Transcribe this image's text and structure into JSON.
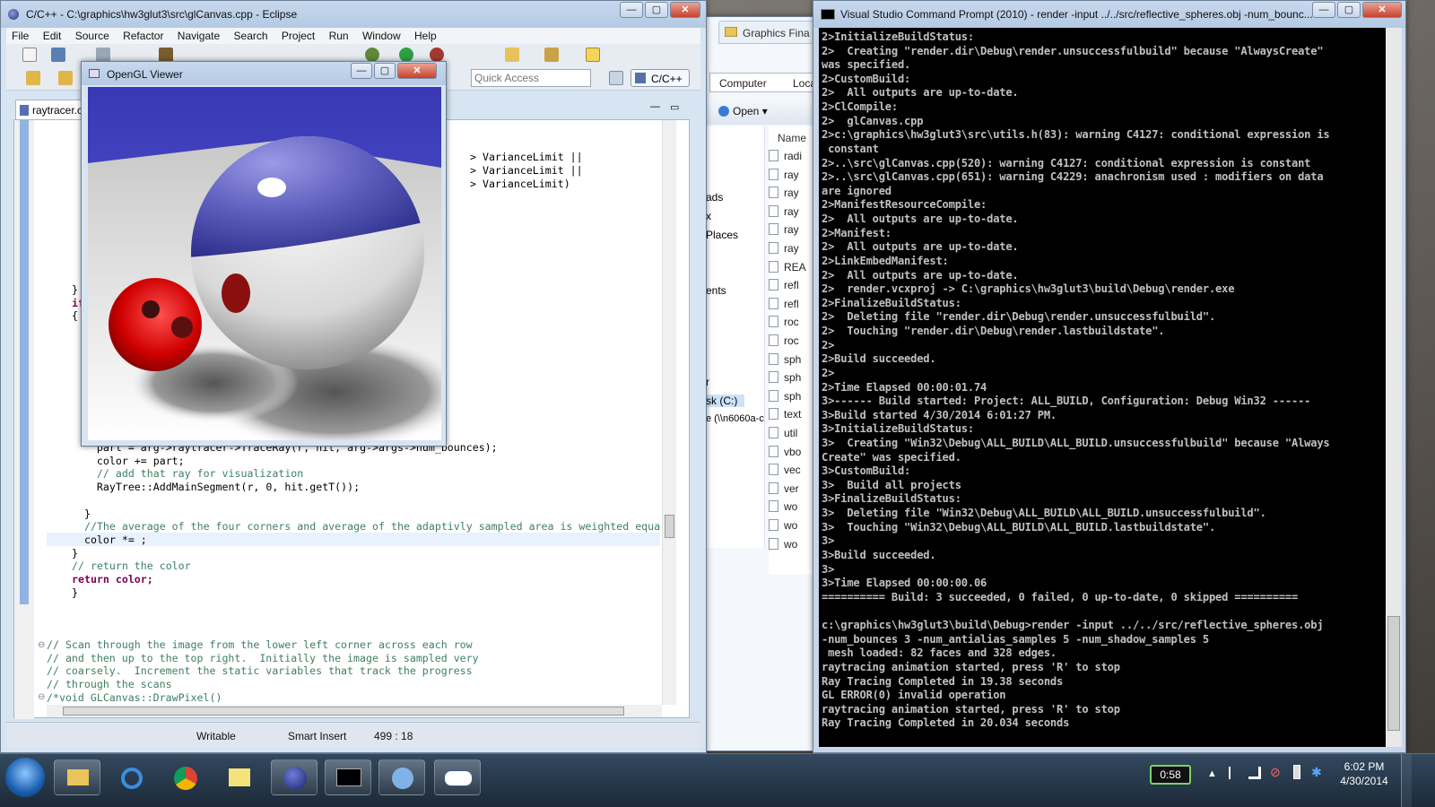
{
  "eclipse": {
    "title": "C/C++ - C:\\graphics\\hw3glut3\\src\\glCanvas.cpp - Eclipse",
    "menu": [
      "File",
      "Edit",
      "Source",
      "Refactor",
      "Navigate",
      "Search",
      "Project",
      "Run",
      "Window",
      "Help"
    ],
    "quick_access": "Quick Access",
    "perspective": "C/C++",
    "tab_label": "raytracer.c",
    "status": {
      "writable": "Writable",
      "insert_mode": "Smart Insert",
      "position": "499 : 18"
    },
    "code_lines_top": [
      {
        "t": "> VarianceLimit ||",
        "c": "code"
      },
      {
        "t": "> VarianceLimit ||",
        "c": "code"
      },
      {
        "t": "> VarianceLimit)",
        "c": "code"
      }
    ],
    "code_fragments": [
      {
        "t": "}",
        "c": "code"
      },
      {
        "t": "if",
        "c": "kw"
      },
      {
        "t": "{",
        "c": "code"
      }
    ],
    "code_lines_bottom": [
      {
        "t": "    part = arg->raytracer->TraceRay(r, hit, arg->args->num_bounces);",
        "c": "code"
      },
      {
        "t": "    color += part;",
        "c": "code"
      },
      {
        "t": "    // add that ray for visualization",
        "c": "cm"
      },
      {
        "t": "    RayTree::AddMainSegment(r, 0, hit.getT());",
        "c": "code"
      },
      {
        "t": "",
        "c": "code"
      },
      {
        "t": "  }",
        "c": "code"
      },
      {
        "t": "  //The average of the four corners and average of the adaptivly sampled area is weighted equa",
        "c": "cm"
      },
      {
        "t": "  color *= ;",
        "c": "code"
      },
      {
        "t": "}",
        "c": "code"
      },
      {
        "t": "// return the color",
        "c": "cm"
      },
      {
        "t": "return color;",
        "c": "kw"
      },
      {
        "t": "}",
        "c": "code"
      }
    ],
    "code_lines_comment": [
      {
        "t": "// Scan through the image from the lower left corner across each row",
        "c": "cm"
      },
      {
        "t": "// and then up to the top right.  Initially the image is sampled very",
        "c": "cm"
      },
      {
        "t": "// coarsely.  Increment the static variables that track the progress",
        "c": "cm"
      },
      {
        "t": "// through the scans",
        "c": "cm"
      },
      {
        "t": "/*void GLCanvas::DrawPixel()",
        "c": "cm"
      }
    ]
  },
  "opengl": {
    "title": "OpenGL Viewer"
  },
  "explorer": {
    "tab_title": "Graphics Fina",
    "breadcrumb": [
      "Computer",
      "Local"
    ],
    "open_button": "Open",
    "sidebar": [
      "ads",
      "x",
      "Places",
      "ents",
      "r",
      "sk (C:)",
      "e (\\\\n6060a-c"
    ],
    "name_header": "Name",
    "files": [
      "radi",
      "ray",
      "ray",
      "ray",
      "ray",
      "ray",
      "REA",
      "refl",
      "refl",
      "roc",
      "roc",
      "sph",
      "sph",
      "sph",
      "text",
      "util",
      "vbo",
      "vec",
      "ver",
      "wo",
      "wo",
      "wo"
    ]
  },
  "terminal": {
    "title": "Visual Studio Command Prompt (2010) - render  -input ../../src/reflective_spheres.obj -num_bounc...",
    "lines": [
      "2>InitializeBuildStatus:",
      "2>  Creating \"render.dir\\Debug\\render.unsuccessfulbuild\" because \"AlwaysCreate\"",
      "was specified.",
      "2>CustomBuild:",
      "2>  All outputs are up-to-date.",
      "2>ClCompile:",
      "2>  glCanvas.cpp",
      "2>c:\\graphics\\hw3glut3\\src\\utils.h(83): warning C4127: conditional expression is",
      " constant",
      "2>..\\src\\glCanvas.cpp(520): warning C4127: conditional expression is constant",
      "2>..\\src\\glCanvas.cpp(651): warning C4229: anachronism used : modifiers on data",
      "are ignored",
      "2>ManifestResourceCompile:",
      "2>  All outputs are up-to-date.",
      "2>Manifest:",
      "2>  All outputs are up-to-date.",
      "2>LinkEmbedManifest:",
      "2>  All outputs are up-to-date.",
      "2>  render.vcxproj -> C:\\graphics\\hw3glut3\\build\\Debug\\render.exe",
      "2>FinalizeBuildStatus:",
      "2>  Deleting file \"render.dir\\Debug\\render.unsuccessfulbuild\".",
      "2>  Touching \"render.dir\\Debug\\render.lastbuildstate\".",
      "2>",
      "2>Build succeeded.",
      "2>",
      "2>Time Elapsed 00:00:01.74",
      "3>------ Build started: Project: ALL_BUILD, Configuration: Debug Win32 ------",
      "3>Build started 4/30/2014 6:01:27 PM.",
      "3>InitializeBuildStatus:",
      "3>  Creating \"Win32\\Debug\\ALL_BUILD\\ALL_BUILD.unsuccessfulbuild\" because \"Always",
      "Create\" was specified.",
      "3>CustomBuild:",
      "3>  Build all projects",
      "3>FinalizeBuildStatus:",
      "3>  Deleting file \"Win32\\Debug\\ALL_BUILD\\ALL_BUILD.unsuccessfulbuild\".",
      "3>  Touching \"Win32\\Debug\\ALL_BUILD\\ALL_BUILD.lastbuildstate\".",
      "3>",
      "3>Build succeeded.",
      "3>",
      "3>Time Elapsed 00:00:00.06",
      "========== Build: 3 succeeded, 0 failed, 0 up-to-date, 0 skipped ==========",
      "",
      "c:\\graphics\\hw3glut3\\build\\Debug>render -input ../../src/reflective_spheres.obj",
      "-num_bounces 3 -num_antialias_samples 5 -num_shadow_samples 5",
      " mesh loaded: 82 faces and 328 edges.",
      "raytracing animation started, press 'R' to stop",
      "Ray Tracing Completed in 19.38 seconds",
      "GL ERROR(0) invalid operation",
      "raytracing animation started, press 'R' to stop",
      "Ray Tracing Completed in 20.034 seconds"
    ]
  },
  "taskbar": {
    "battery": "0:58",
    "time": "6:02 PM",
    "date": "4/30/2014"
  }
}
